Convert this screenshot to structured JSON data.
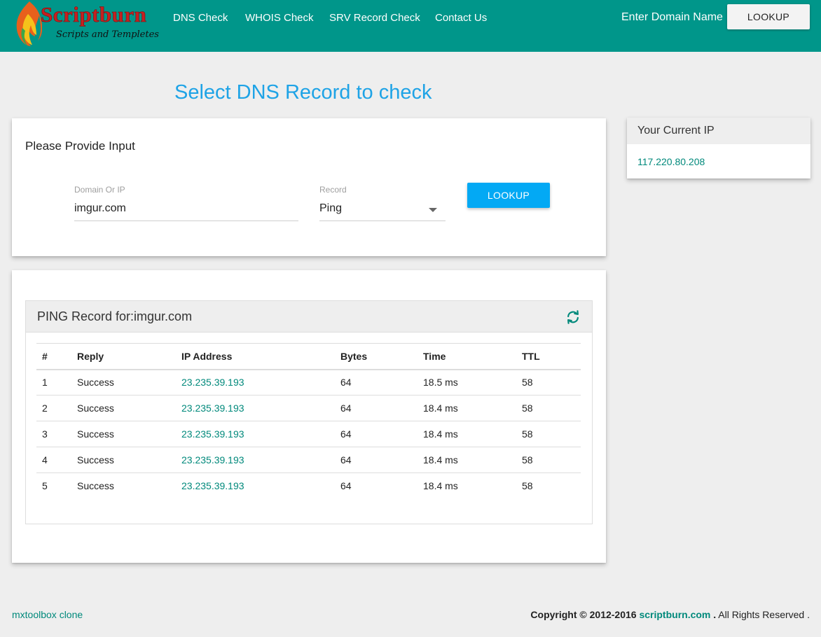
{
  "header": {
    "logo_title": "Scriptburn",
    "logo_subtitle": "Scripts and Templetes",
    "nav": [
      {
        "label": "DNS Check"
      },
      {
        "label": "WHOIS Check"
      },
      {
        "label": "SRV Record Check"
      },
      {
        "label": "Contact Us"
      }
    ],
    "domain_label": "Enter Domain Name",
    "lookup_button": "LOOKUP"
  },
  "page_title": "Select DNS Record to check",
  "input_card": {
    "title": "Please Provide Input",
    "domain_label": "Domain Or IP",
    "domain_value": "imgur.com",
    "record_label": "Record",
    "record_value": "Ping",
    "lookup_button": "LOOKUP"
  },
  "ip_card": {
    "title": "Your Current IP",
    "value": "117.220.80.208"
  },
  "results": {
    "title": "PING Record for:imgur.com",
    "columns": [
      "#",
      "Reply",
      "IP Address",
      "Bytes",
      "Time",
      "TTL"
    ],
    "rows": [
      {
        "n": "1",
        "reply": "Success",
        "ip": "23.235.39.193",
        "bytes": "64",
        "time": "18.5 ms",
        "ttl": "58"
      },
      {
        "n": "2",
        "reply": "Success",
        "ip": "23.235.39.193",
        "bytes": "64",
        "time": "18.4 ms",
        "ttl": "58"
      },
      {
        "n": "3",
        "reply": "Success",
        "ip": "23.235.39.193",
        "bytes": "64",
        "time": "18.4 ms",
        "ttl": "58"
      },
      {
        "n": "4",
        "reply": "Success",
        "ip": "23.235.39.193",
        "bytes": "64",
        "time": "18.4 ms",
        "ttl": "58"
      },
      {
        "n": "5",
        "reply": "Success",
        "ip": "23.235.39.193",
        "bytes": "64",
        "time": "18.4 ms",
        "ttl": "58"
      }
    ]
  },
  "footer": {
    "left_link": "mxtoolbox clone",
    "copyright": "Copyright © 2012-2016",
    "site": "scriptburn.com",
    "dot": ".",
    "rights": "All Rights Reserved ."
  },
  "colors": {
    "navbar": "#00968a",
    "accent_blue": "#03a9f4",
    "title_blue": "#1ea3e6",
    "link_teal": "#00897b",
    "logo_red": "#c62020"
  },
  "icons": {
    "logo": "flame-icon",
    "record_select": "caret-down-icon",
    "refresh": "refresh-icon"
  }
}
